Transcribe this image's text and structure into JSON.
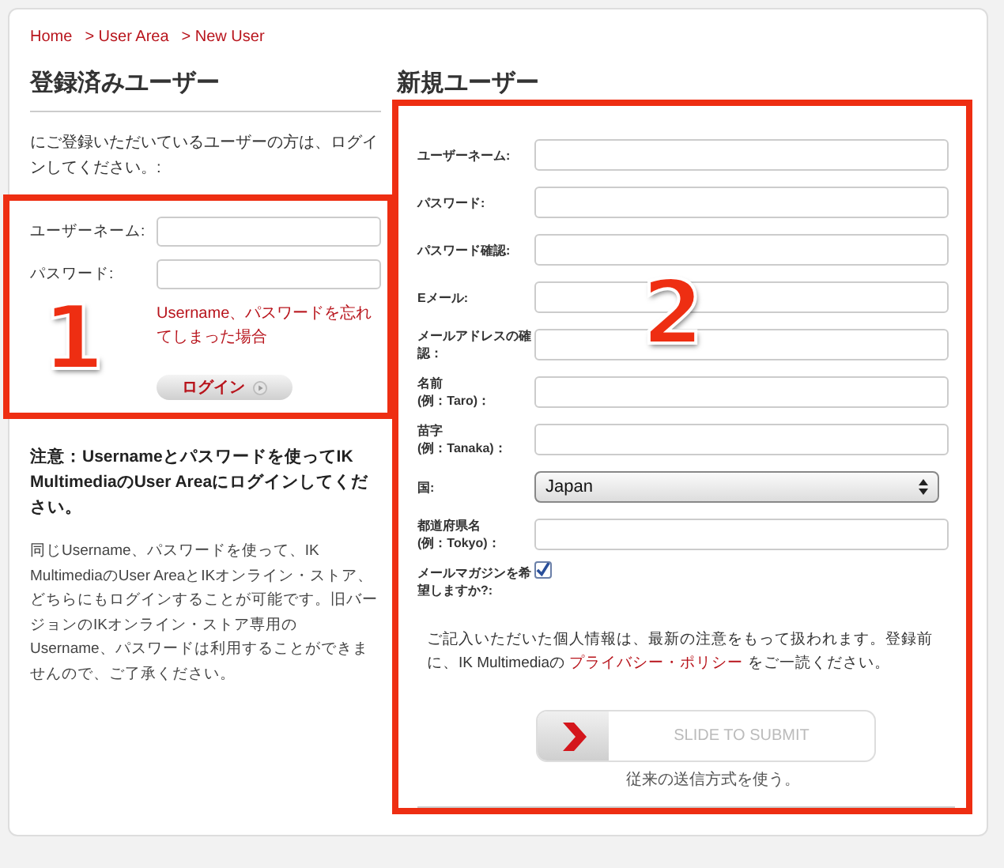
{
  "breadcrumb": [
    {
      "label": "Home"
    },
    {
      "label": "> User Area"
    },
    {
      "label": "> New User"
    }
  ],
  "registered": {
    "heading": "登録済みユーザー",
    "intro": "にご登録いただいているユーザーの方は、ログインしてください。:",
    "fields": [
      {
        "label": "ユーザーネーム:"
      },
      {
        "label": "パスワード:"
      }
    ],
    "forgot_link": "Username、パスワードを忘れてしまった場合",
    "login_button": "ログイン",
    "note": "注意：Usernameとパスワードを使ってIK MultimediaのUser Areaにログインしてください。",
    "description": "同じUsername、パスワードを使って、IK MultimediaのUser AreaとIKオンライン・ストア、どちらにもログインすることが可能です。旧バージョンのIKオンライン・ストア専用のUsername、パスワードは利用することができませんので、ご了承ください。"
  },
  "new_user": {
    "heading": "新規ユーザー",
    "fields": [
      {
        "kind": "text",
        "label": "ユーザーネーム:"
      },
      {
        "kind": "text",
        "label": "パスワード:"
      },
      {
        "kind": "text",
        "label": "パスワード確認:"
      },
      {
        "kind": "text",
        "label": "Eメール:"
      },
      {
        "kind": "text",
        "label": "メールアドレスの確認："
      },
      {
        "kind": "text",
        "label": "名前\n(例：Taro)："
      },
      {
        "kind": "text",
        "label": "苗字\n(例：Tanaka)："
      },
      {
        "kind": "select",
        "label": "国:",
        "value": "Japan"
      },
      {
        "kind": "text",
        "label": "都道府県名\n(例：Tokyo)："
      },
      {
        "kind": "checkbox",
        "label": "メールマガジンを希望しますか?:",
        "checked": true
      }
    ],
    "privacy_text": "ご記入いただいた個人情報は、最新の注意をもって扱われます。登録前に、IK Multimediaの ",
    "privacy_link": "プライバシー・ポリシー",
    "privacy_suffix": " をご一読ください。",
    "slider": {
      "label": "SLIDE TO SUBMIT",
      "level": 0
    },
    "fallback": "従来の送信方式を使う。"
  },
  "annotations": [
    {
      "label": "1"
    },
    {
      "label": "2"
    }
  ]
}
